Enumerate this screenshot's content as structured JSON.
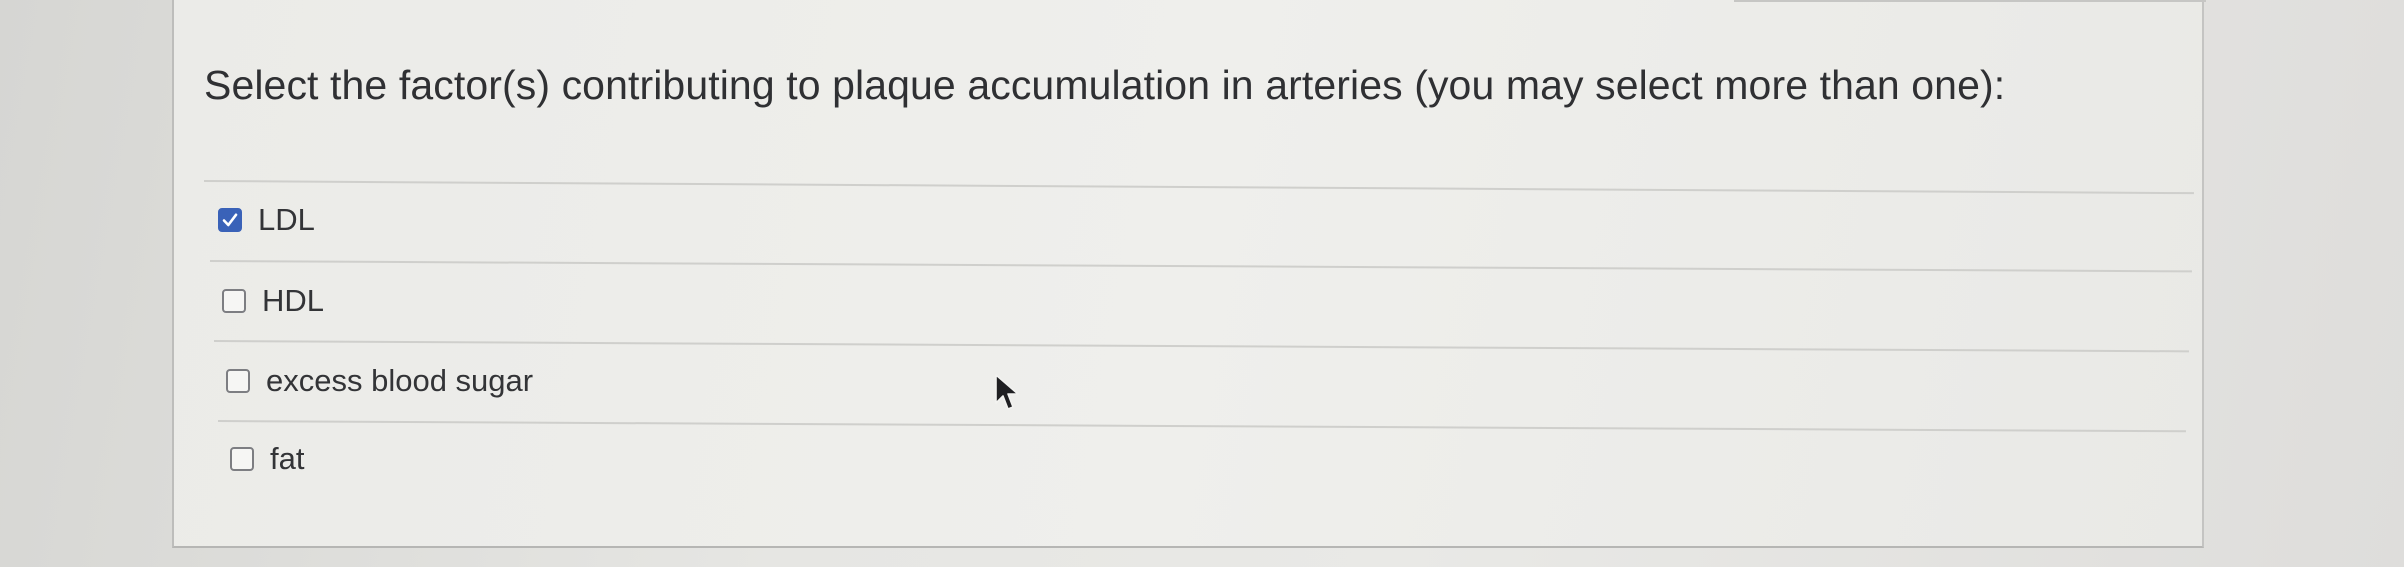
{
  "question": {
    "text": "Select the factor(s) contributing to plaque accumulation in arteries (you may select more than one):"
  },
  "options": [
    {
      "label": "LDL",
      "checked": true
    },
    {
      "label": "HDL",
      "checked": false
    },
    {
      "label": "excess blood sugar",
      "checked": false
    },
    {
      "label": "fat",
      "checked": false
    }
  ],
  "icons": {
    "checked": "checkmark-icon",
    "cursor": "mouse-pointer-icon"
  },
  "colors": {
    "checkbox_checked": "#3a62b8",
    "text": "#2f3033"
  }
}
